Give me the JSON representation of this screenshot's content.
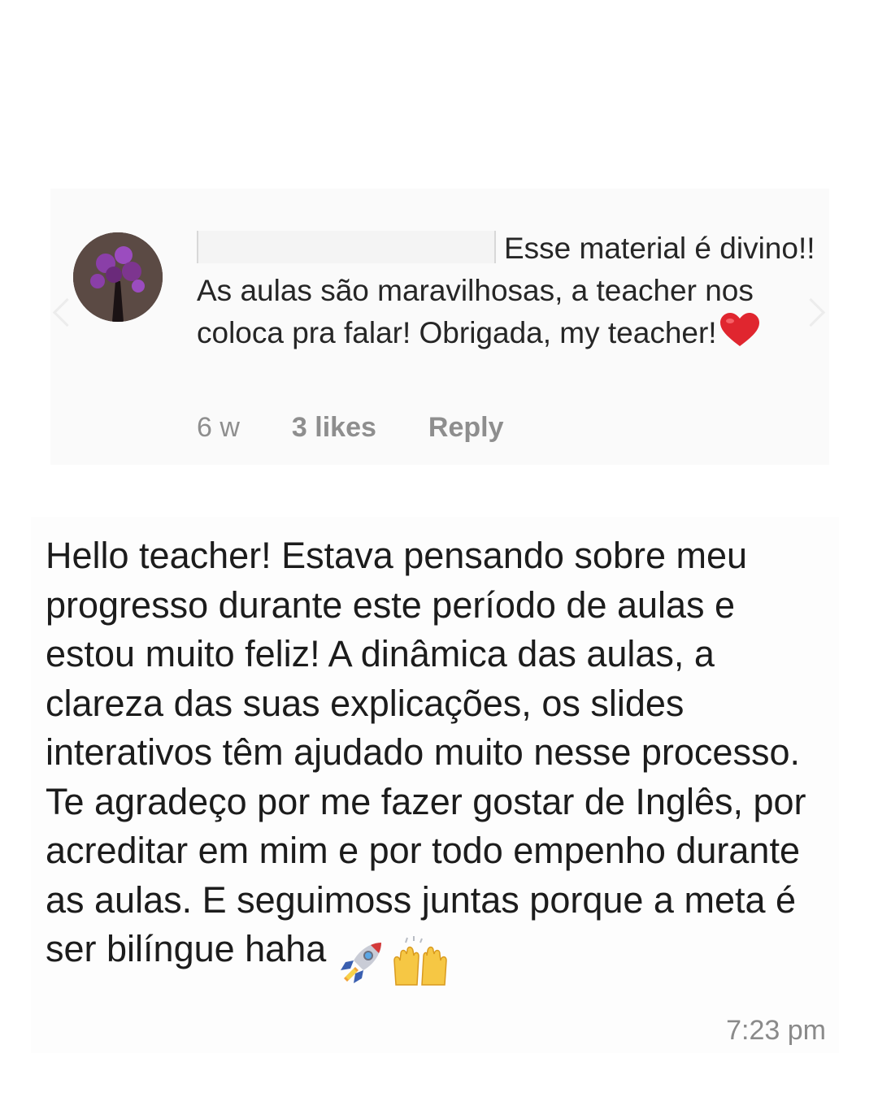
{
  "comment": {
    "text": "Esse material é divino!! As aulas são maravilhosas, a teacher nos coloca pra falar! Obrigada, my teacher!",
    "time": "6 w",
    "likes": "3 likes",
    "reply_label": "Reply",
    "heart_icon": "red-heart-icon",
    "heart_color": "#e0262f"
  },
  "message": {
    "text": "Hello teacher! Estava pensando sobre meu progresso durante este período de aulas e estou muito feliz! A dinâmica das aulas, a clareza das suas explicações, os slides interativos têm ajudado muito nesse processo. Te agradeço por me fazer gostar de Inglês, por acreditar em mim e por todo empenho durante as aulas. E seguimoss juntas porque a meta é ser bilíngue haha",
    "time": "7:23 pm",
    "emojis": [
      "rocket-icon",
      "raising-hands-icon"
    ]
  }
}
